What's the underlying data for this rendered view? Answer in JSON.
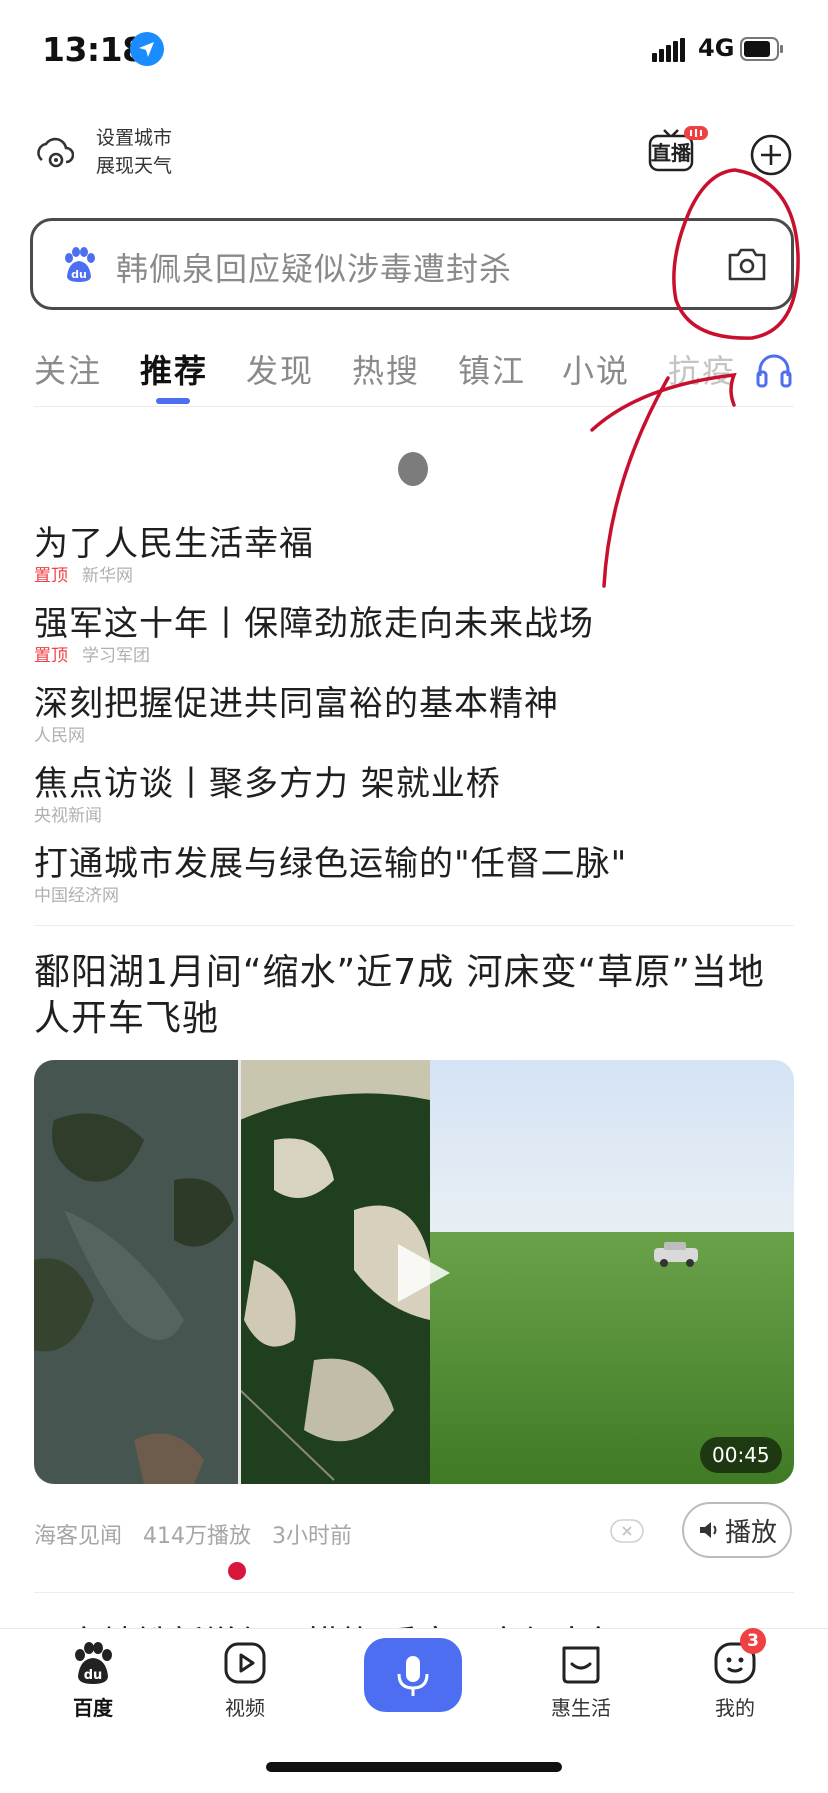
{
  "status_bar": {
    "time": "13:18",
    "network": "4G"
  },
  "header": {
    "weather_line1": "设置城市",
    "weather_line2": "展现天气",
    "live_label": "直播"
  },
  "search": {
    "placeholder": "韩佩泉回应疑似涉毒遭封杀"
  },
  "tabs": [
    {
      "label": "关注"
    },
    {
      "label": "推荐",
      "active": true
    },
    {
      "label": "发现"
    },
    {
      "label": "热搜"
    },
    {
      "label": "镇江"
    },
    {
      "label": "小说"
    },
    {
      "label": "抗疫"
    }
  ],
  "hot_list": [
    {
      "title": "为了人民生活幸福",
      "pin": "置顶",
      "source": "新华网"
    },
    {
      "title": "强军这十年丨保障劲旅走向未来战场",
      "pin": "置顶",
      "source": "学习军团"
    },
    {
      "title": "深刻把握促进共同富裕的基本精神",
      "pin": "",
      "source": "人民网"
    },
    {
      "title": "焦点访谈丨聚多方力 架就业桥",
      "pin": "",
      "source": "央视新闻"
    },
    {
      "title": "打通城市发展与绿色运输的\"任督二脉\"",
      "pin": "",
      "source": "中国经济网"
    }
  ],
  "feed_card": {
    "title": "鄱阳湖1月间“缩水”近7成 河床变“草原”当地人开车飞驰",
    "duration": "00:45",
    "author": "海客见闻",
    "plays": "414万播放",
    "time_ago": "3小时前",
    "play_button_label": "播放"
  },
  "next_card_peek": "西安地铁新增便民措施 乘客更方便出行",
  "bottom_nav": {
    "home": "百度",
    "video": "视频",
    "life": "惠生活",
    "mine": "我的",
    "mine_badge": "3"
  },
  "colors": {
    "accent": "#4e6ef2",
    "pin_red": "#f04142",
    "annotation_red": "#c8102e"
  }
}
